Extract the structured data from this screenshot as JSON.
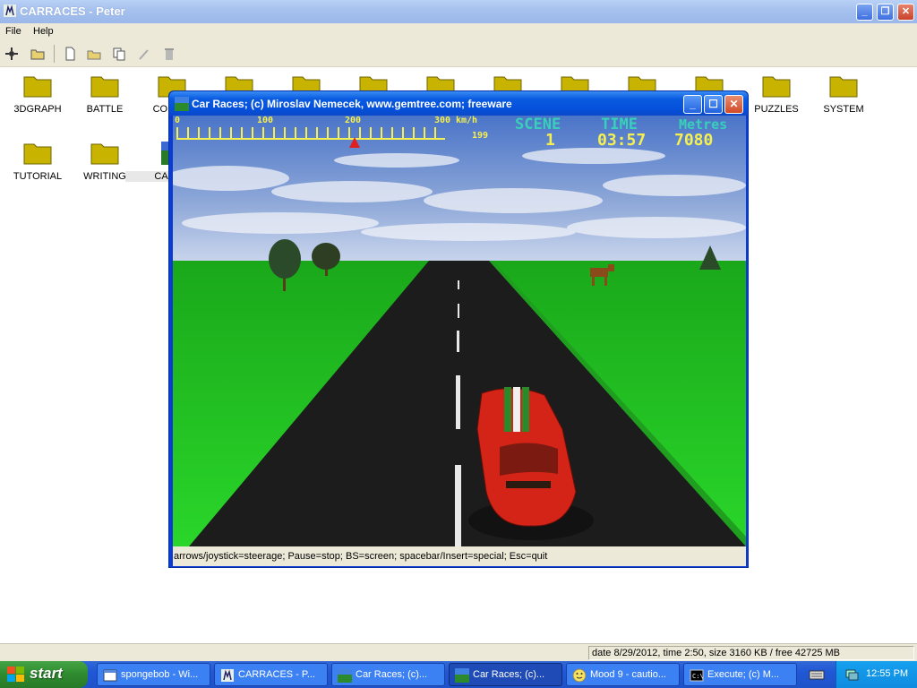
{
  "main_window": {
    "title": "CARRACES - Peter",
    "menu": [
      "File",
      "Help"
    ]
  },
  "folders": [
    {
      "label": "3DGRAPH"
    },
    {
      "label": "BATTLE"
    },
    {
      "label": "COMM"
    },
    {
      "label": "PUZZLES"
    },
    {
      "label": "SYSTEM"
    },
    {
      "label": "TUTORIAL"
    },
    {
      "label": "WRITING"
    },
    {
      "label": "CARR"
    }
  ],
  "status_bar": {
    "text": "date 8/29/2012, time 2:50, size 3160 KB / free 42725 MB"
  },
  "game_window": {
    "title": "Car Races;  (c) Miroslav Nemecek, www.gemtree.com;  freeware",
    "info_bar": "arrows/joystick=steerage;  Pause=stop;  BS=screen;  spacebar/Insert=special;  Esc=quit",
    "hud": {
      "speed_ticks": [
        "0",
        "100",
        "200",
        "300"
      ],
      "speed_unit": "km/h",
      "speed_value": "199",
      "speed_fraction": 0.663,
      "scene_label": "SCENE",
      "scene_value": "1",
      "time_label": "TIME",
      "time_value": "03:57",
      "metres_label": "Metres",
      "metres_value": "7080"
    }
  },
  "taskbar": {
    "start_label": "start",
    "tasks": [
      {
        "label": "spongebob - Wi...",
        "icon": "ie-icon"
      },
      {
        "label": "CARRACES - P...",
        "icon": "peter-icon"
      },
      {
        "label": "Car Races;  (c)...",
        "icon": "game-icon"
      },
      {
        "label": "Car Races;  (c)...",
        "icon": "game-icon"
      },
      {
        "label": "Mood 9 - cautio...",
        "icon": "smiley-icon"
      },
      {
        "label": "Execute;  (c) M...",
        "icon": "console-icon"
      }
    ],
    "clock": "12:55 PM"
  },
  "colors": {
    "hud_cyan": "#38d0b8",
    "hud_yellow": "#f5f050",
    "grass": "#22c422",
    "road": "#1c1c1c",
    "car": "#d42418"
  }
}
